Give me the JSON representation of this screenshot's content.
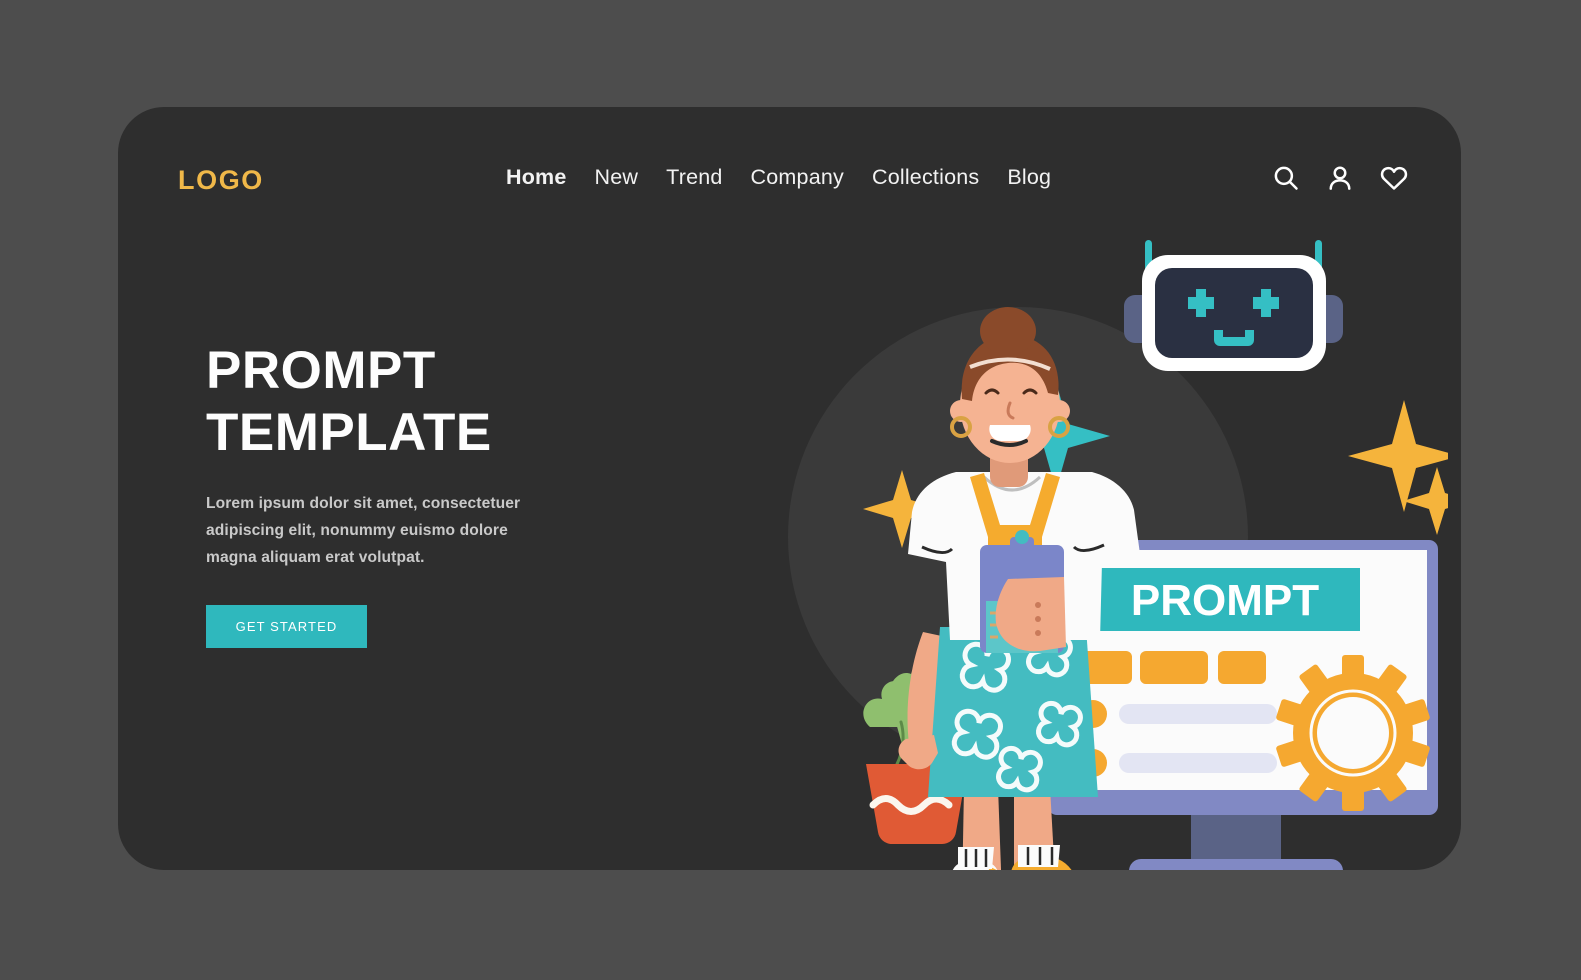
{
  "page": {
    "background_color": "#4d4d4d",
    "card_color": "#2e2e2e"
  },
  "header": {
    "logo": "LOGO",
    "nav": [
      {
        "label": "Home",
        "active": true
      },
      {
        "label": "New",
        "active": false
      },
      {
        "label": "Trend",
        "active": false
      },
      {
        "label": "Company",
        "active": false
      },
      {
        "label": "Collections",
        "active": false
      },
      {
        "label": "Blog",
        "active": false
      }
    ],
    "icons": [
      {
        "name": "search-icon"
      },
      {
        "name": "user-icon"
      },
      {
        "name": "heart-icon"
      }
    ]
  },
  "hero": {
    "headline_line1": "PROMPT",
    "headline_line2": "TEMPLATE",
    "body": "Lorem ipsum dolor sit amet, consectetuer adipiscing elit, nonummy euismo dolore magna aliquam erat volutpat.",
    "cta_label": "GET STARTED",
    "cta_color": "#2fb8bd",
    "logo_color": "#f0b849"
  },
  "illustration": {
    "monitor_screen_title": "PROMPT",
    "banner_color": "#2fb8bd",
    "accent_orange": "#f5a830",
    "monitor_frame_color": "#8189c4",
    "robot_eye_color": "#35bfc4",
    "sparkle_colors": [
      "#f5b43c",
      "#35bfc4"
    ],
    "elements": [
      "robot-head",
      "monitor",
      "prompt-banner",
      "tag-chips",
      "list-rows",
      "gear-icon",
      "woman-character",
      "clipboard",
      "potted-plant",
      "sparkles"
    ]
  }
}
